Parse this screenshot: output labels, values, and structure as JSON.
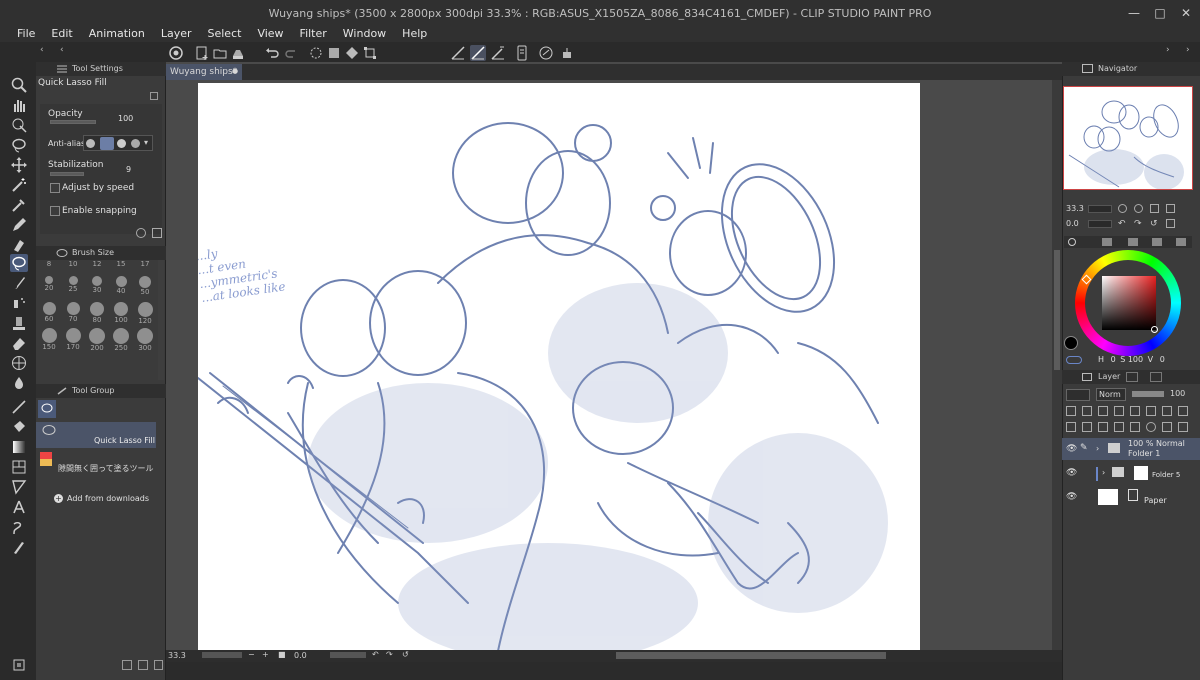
{
  "window": {
    "title": "Wuyang ships* (3500 x 2800px 300dpi 33.3% : RGB:ASUS_X1505ZA_8086_834C4161_CMDEF) - CLIP STUDIO PAINT PRO",
    "min": "—",
    "max": "□",
    "close": "✕"
  },
  "menu": [
    "File",
    "Edit",
    "Animation",
    "Layer",
    "Select",
    "View",
    "Filter",
    "Window",
    "Help"
  ],
  "tool_settings": {
    "header": "Tool Settings",
    "tool_name": "Quick Lasso Fill",
    "opacity_label": "Opacity",
    "opacity_value": "100",
    "antialias_label": "Anti-alias",
    "stabilization_label": "Stabilization",
    "stabilization_value": "9",
    "adjust_speed_label": "Adjust by speed",
    "snapping_label": "Enable snapping"
  },
  "brush_size": {
    "header": "Brush Size",
    "sizes": [
      "8",
      "10",
      "12",
      "15",
      "17",
      "20",
      "25",
      "30",
      "40",
      "50",
      "60",
      "70",
      "80",
      "100",
      "120",
      "150",
      "170",
      "200",
      "250",
      "300"
    ]
  },
  "tool_group": {
    "header": "Tool Group",
    "items": [
      "Quick Lasso Fill",
      "隙間無く囲って塗るツール"
    ],
    "add_label": "Add from downloads"
  },
  "document": {
    "tab_label": "Wuyang ships*",
    "tab_close": "●",
    "zoom": "33.3",
    "rotation": "0.0",
    "sketch_note": [
      "...ly",
      "...t even",
      "...ymmetric's",
      "...at looks like"
    ]
  },
  "navigator": {
    "header": "Navigator",
    "zoom": "33.3",
    "rotation": "0.0"
  },
  "color": {
    "h_label": "H",
    "h": "0",
    "s_label": "S",
    "s": "100",
    "v_label": "V",
    "v": "0",
    "main_color": "#000000",
    "accent": "#e82020"
  },
  "layer_panel": {
    "header": "Layer",
    "blend_mode": "Norm",
    "opacity": "100",
    "layers": [
      {
        "label": "100 % Normal",
        "name": "Folder 1"
      },
      {
        "label": "",
        "name": "Folder 5"
      },
      {
        "label": "",
        "name": "Paper"
      }
    ]
  }
}
